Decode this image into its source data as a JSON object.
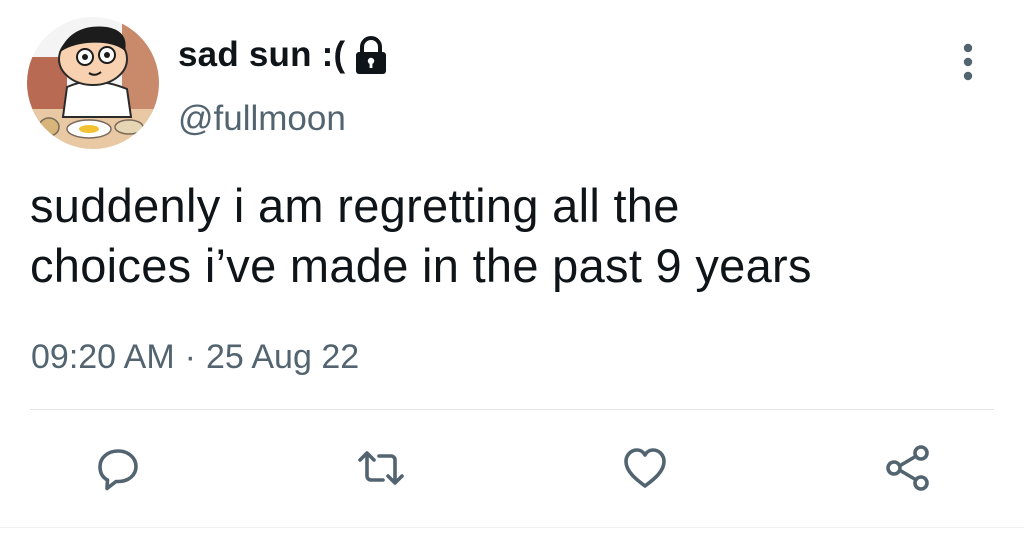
{
  "author": {
    "display_name": "sad sun :(",
    "handle": "@fullmoon",
    "protected": true
  },
  "tweet": {
    "text": "suddenly i am regretting all the\nchoices i’ve made in the past 9 years",
    "time": "09:20 AM",
    "separator": "·",
    "date": "25 Aug 22"
  },
  "icons": {
    "lock": "lock-icon",
    "more": "more-vertical-icon",
    "reply": "reply-icon",
    "retweet": "retweet-icon",
    "like": "heart-icon",
    "share": "share-icon"
  },
  "colors": {
    "text_primary": "#0f1419",
    "text_secondary": "#536471",
    "divider": "#e1e4e8"
  }
}
